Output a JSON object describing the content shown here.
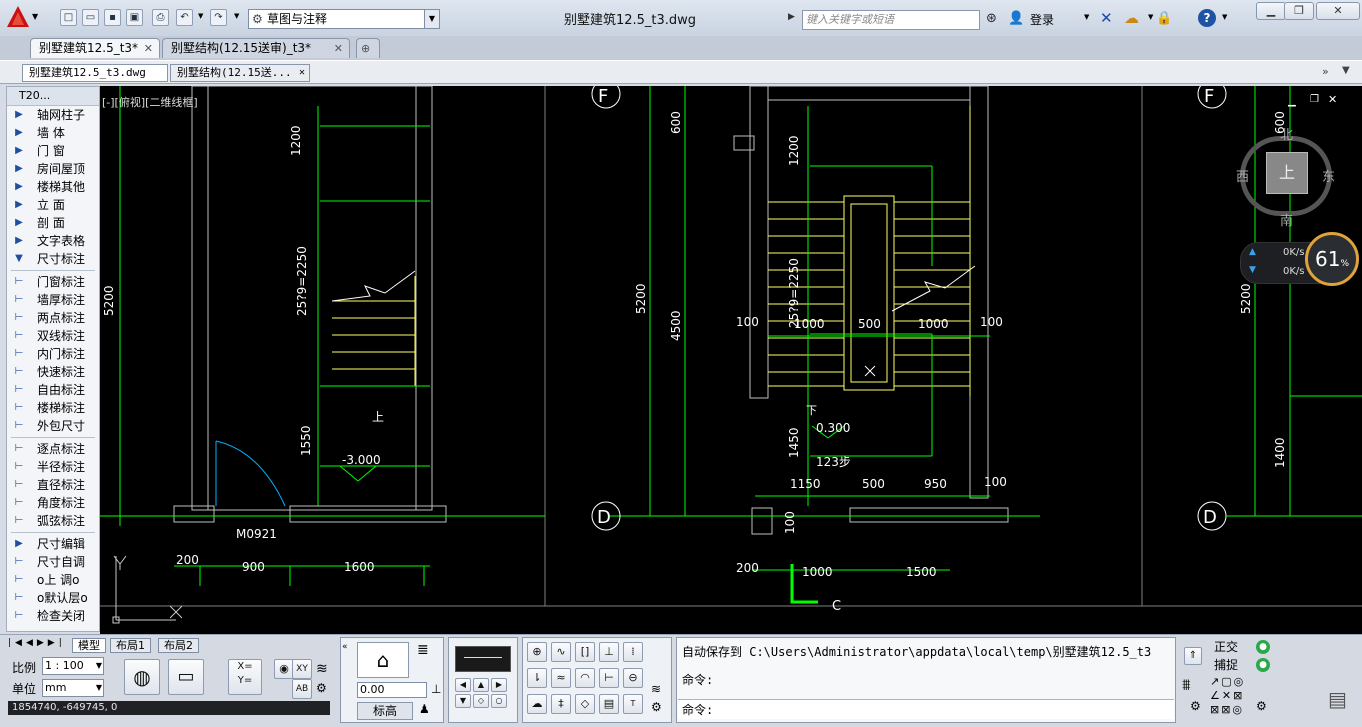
{
  "app": {
    "doc_title": "别墅建筑12.5_t3.dwg",
    "workspace": "草图与注释",
    "search_placeholder": "键入关键字或短语",
    "login_label": "登录"
  },
  "file_tabs": [
    {
      "label": "别墅建筑12.5_t3*",
      "active": true
    },
    {
      "label": "别墅结构(12.15送审)_t3*",
      "active": false
    }
  ],
  "sub_tabs": [
    {
      "label": "别墅建筑12.5_t3.dwg"
    },
    {
      "label": "别墅结构(12.15送..."
    }
  ],
  "palette": {
    "title": "T20...",
    "menu_items": [
      {
        "label": "轴网柱子",
        "icon": "triangle-right-icon"
      },
      {
        "label": "墙    体",
        "icon": "triangle-right-icon"
      },
      {
        "label": "门    窗",
        "icon": "triangle-right-icon"
      },
      {
        "label": "房间屋顶",
        "icon": "triangle-right-icon"
      },
      {
        "label": "楼梯其他",
        "icon": "triangle-right-icon"
      },
      {
        "label": "立    面",
        "icon": "triangle-right-icon"
      },
      {
        "label": "剖    面",
        "icon": "triangle-right-icon"
      },
      {
        "label": "文字表格",
        "icon": "triangle-right-icon"
      },
      {
        "label": "尺寸标注",
        "icon": "triangle-down-icon"
      }
    ],
    "dim_tools_a": [
      {
        "label": "门窗标注",
        "icon": "door-window-dim-icon"
      },
      {
        "label": "墙厚标注",
        "icon": "wall-thickness-dim-icon"
      },
      {
        "label": "两点标注",
        "icon": "two-point-dim-icon"
      },
      {
        "label": "双线标注",
        "icon": "double-line-dim-icon"
      },
      {
        "label": "内门标注",
        "icon": "inner-door-dim-icon"
      },
      {
        "label": "快速标注",
        "icon": "quick-dim-icon"
      },
      {
        "label": "自由标注",
        "icon": "free-dim-icon"
      },
      {
        "label": "楼梯标注",
        "icon": "stair-dim-icon"
      },
      {
        "label": "外包尺寸",
        "icon": "outer-dim-icon"
      }
    ],
    "dim_tools_b": [
      {
        "label": "逐点标注",
        "icon": "point-dim-icon"
      },
      {
        "label": "半径标注",
        "icon": "radius-dim-icon"
      },
      {
        "label": "直径标注",
        "icon": "diameter-dim-icon"
      },
      {
        "label": "角度标注",
        "icon": "angle-dim-icon"
      },
      {
        "label": "弧弦标注",
        "icon": "arc-chord-dim-icon"
      }
    ],
    "dim_tools_c": [
      {
        "label": "尺寸编辑",
        "icon": "triangle-right-icon"
      },
      {
        "label": "尺寸自调",
        "icon": "dim-auto-icon"
      },
      {
        "label": "o上  调o",
        "icon": "dim-up-icon"
      },
      {
        "label": "o默认层o",
        "icon": "default-layer-icon"
      },
      {
        "label": "检查关闭",
        "icon": "check-close-icon"
      }
    ]
  },
  "viewport": {
    "label": "[-][俯视][二维线框]",
    "viewcube": {
      "north": "北",
      "south": "南",
      "east": "东",
      "west": "西",
      "face": "上"
    },
    "net": {
      "up": "0K/s",
      "down": "0K/s",
      "cpu": "61",
      "cpu_unit": "%"
    }
  },
  "drawing": {
    "left": {
      "dims": [
        "1200",
        "25?9=2250",
        "1550",
        "5200",
        "200",
        "900",
        "1600"
      ],
      "elev": "-3.000",
      "door": "M0921",
      "up": "上"
    },
    "mid": {
      "dims": [
        "600",
        "1200",
        "25?9=2250",
        "1450",
        "5200",
        "4500",
        "100",
        "1000",
        "500",
        "1000",
        "100",
        "1150",
        "500",
        "950",
        "100",
        "100",
        "200",
        "1000",
        "1500"
      ],
      "elev": "0.300",
      "steps": "123步",
      "down": "下",
      "axis_f": "F",
      "axis_d": "D",
      "axis_c": "C"
    },
    "right": {
      "dims": [
        "600",
        "5200",
        "1400"
      ],
      "axis_f": "F",
      "axis_d": "D"
    }
  },
  "layout_tabs": [
    "模型",
    "布局1",
    "布局2"
  ],
  "scale": {
    "label": "比例",
    "value": "1 : 100",
    "unit_label": "单位",
    "unit_value": "mm"
  },
  "coordinates": "1854740, -649745, 0",
  "tool_panel": {
    "elev_value": "0.00",
    "elev_label": "标高"
  },
  "command": {
    "autosave_text": "自动保存到 C:\\Users\\Administrator\\appdata\\local\\temp\\别墅建筑12.5_t3",
    "prompt1": "命令:",
    "prompt2": "命令:"
  },
  "status_toggles": [
    {
      "label": "正交",
      "state": "on"
    },
    {
      "label": "捕捉",
      "state": "on"
    }
  ],
  "colors": {
    "canvas": "#000000",
    "line": "#00ff00",
    "wall": "#c0c0c0",
    "stair": "#ffff66",
    "text": "#ffffff"
  }
}
